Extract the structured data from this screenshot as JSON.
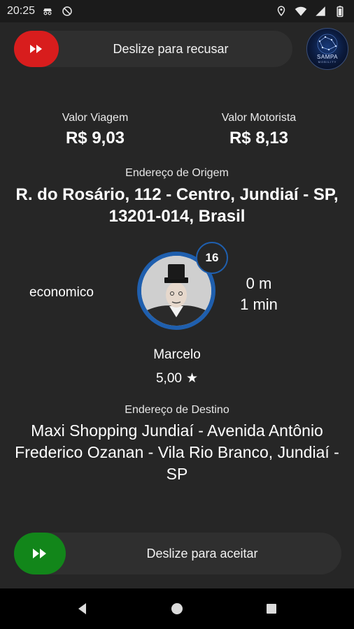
{
  "status_bar": {
    "time": "20:25",
    "icons_left": [
      "incognito-icon",
      "blocked-icon"
    ],
    "icons_right": [
      "location-icon",
      "wifi-icon",
      "signal-icon",
      "battery-icon"
    ]
  },
  "reject": {
    "label": "Deslize para recusar",
    "color": "#d81d1d"
  },
  "logo": {
    "text": "SAMPA",
    "sub": "MOBILITY"
  },
  "fares": {
    "travel_caption": "Valor Viagem",
    "travel_value": "R$ 9,03",
    "driver_caption": "Valor Motorista",
    "driver_value": "R$ 8,13"
  },
  "origin": {
    "label": "Endereço de Origem",
    "address": "R. do Rosário, 112 - Centro, Jundiaí - SP, 13201-014, Brasil"
  },
  "ride": {
    "category": "economico",
    "badge_count": "16",
    "distance": "0 m",
    "duration": "1 min",
    "accent": "#1f5fae"
  },
  "passenger": {
    "name": "Marcelo",
    "rating": "5,00",
    "star": "★"
  },
  "destination": {
    "label": "Endereço de Destino",
    "address": "Maxi Shopping Jundiaí - Avenida Antônio Frederico Ozanan - Vila Rio Branco, Jundiaí - SP"
  },
  "accept": {
    "label": "Deslize para aceitar",
    "color": "#12861a"
  },
  "nav": {
    "buttons": [
      "back-icon",
      "home-icon",
      "recents-icon"
    ]
  }
}
